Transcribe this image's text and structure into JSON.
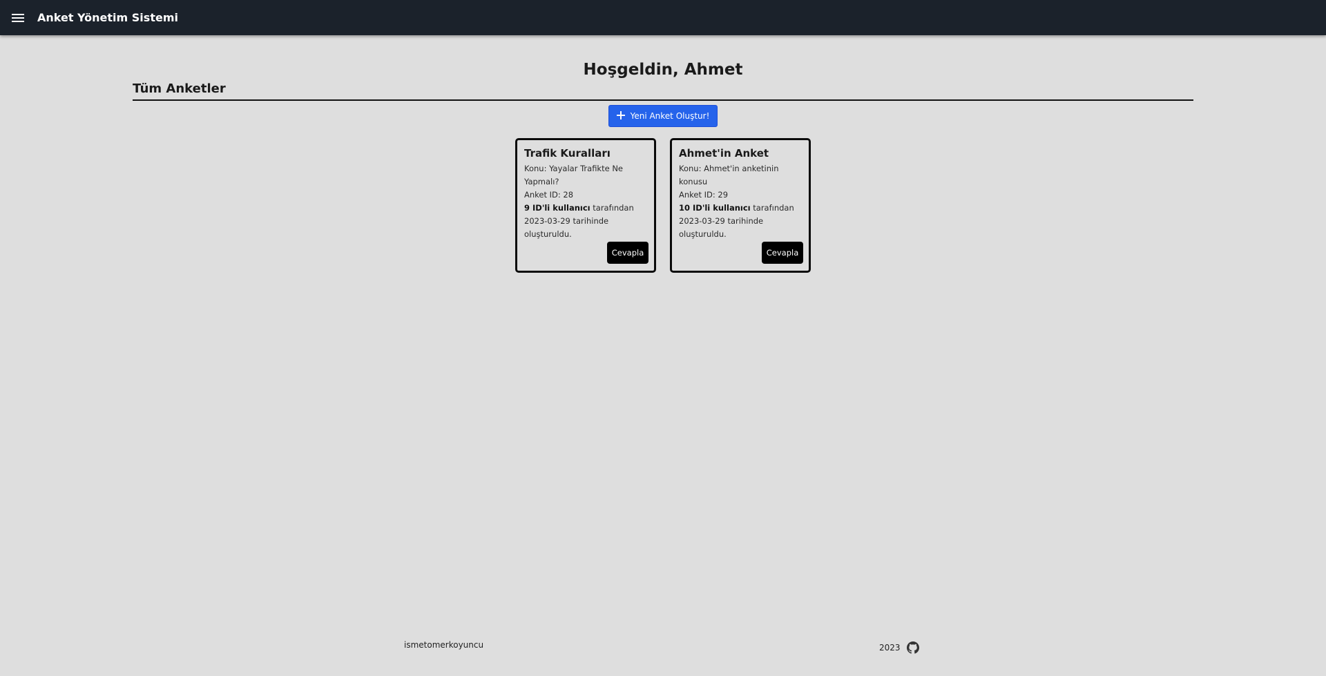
{
  "header": {
    "menu_icon": "hamburger-menu-icon",
    "title": "Anket Yönetim Sistemi"
  },
  "main": {
    "welcome": "Hoşgeldin, Ahmet",
    "section_title": "Tüm Anketler",
    "new_survey_label": "Yeni Anket Oluştur!",
    "new_survey_icon": "plus-icon",
    "accent_color": "#2563eb"
  },
  "surveys": [
    {
      "title": "Trafik Kuralları",
      "topic": "Konu: Yayalar Trafikte Ne Yapmalı?",
      "id_line": "Anket ID: 28",
      "creator_bold": "9 ID'li kullanıcı",
      "creator_rest": " tarafından 2023-03-29 tarihinde oluşturuldu.",
      "answer_label": "Cevapla"
    },
    {
      "title": "Ahmet'in Anket",
      "topic": "Konu: Ahmet'in anketinin konusu",
      "id_line": "Anket ID: 29",
      "creator_bold": "10 ID'li kullanıcı",
      "creator_rest": " tarafından 2023-03-29 tarihinde oluşturuldu.",
      "answer_label": "Cevapla"
    }
  ],
  "footer": {
    "author": "ismetomerkoyuncu",
    "year": "2023",
    "github_icon": "github-icon"
  }
}
